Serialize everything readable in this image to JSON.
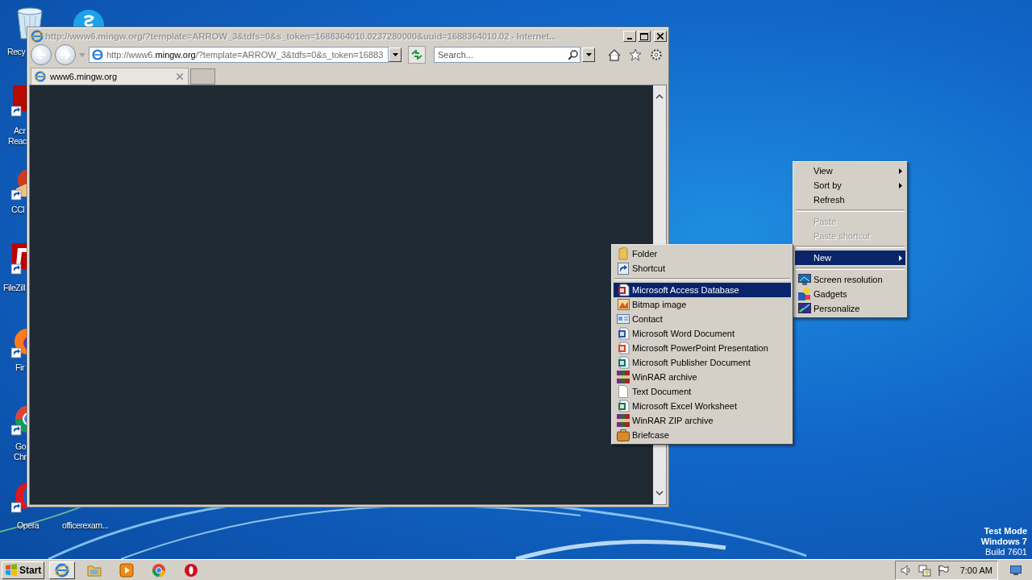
{
  "desktop": {
    "icons": [
      {
        "kind": "recycle",
        "lines": [
          "Recy"
        ]
      },
      {
        "kind": "skype"
      },
      {
        "kind": "pdf",
        "lines": [
          "Acr",
          "Reac"
        ]
      },
      {
        "kind": "ccleaner",
        "lines": [
          "CCl"
        ]
      },
      {
        "kind": "filezilla",
        "lines": [
          "FileZill"
        ]
      },
      {
        "kind": "firefox",
        "lines": [
          "Fir"
        ]
      },
      {
        "kind": "chrome",
        "lines": [
          "Go",
          "Chr"
        ]
      },
      {
        "kind": "opera",
        "lines": [
          "Opera"
        ]
      },
      {
        "kind": "file",
        "lines": [
          "officerexam..."
        ]
      }
    ],
    "os_notice": [
      "Test Mode",
      "Windows 7",
      "Build 7601"
    ]
  },
  "browser": {
    "title": "http://www6.mingw.org/?template=ARROW_3&tdfs=0&s_token=1688364010.0237280000&uuid=1688364010.02 - Internet...",
    "address": {
      "prefix": "http://www6.",
      "domain": "mingw.org",
      "suffix": "/?template=ARROW_3&tdfs=0&s_token=16883"
    },
    "search": {
      "placeholder": "Search..."
    },
    "tabs": [
      {
        "label": "www6.mingw.org",
        "selected": true
      }
    ]
  },
  "context_menu": {
    "items": [
      {
        "kind": "item",
        "label": "View",
        "submenu": true,
        "disabled": false,
        "selected": false
      },
      {
        "kind": "item",
        "label": "Sort by",
        "submenu": true,
        "disabled": false,
        "selected": false
      },
      {
        "kind": "item",
        "label": "Refresh",
        "submenu": false,
        "disabled": false,
        "selected": false
      },
      {
        "kind": "separator"
      },
      {
        "kind": "item",
        "label": "Paste",
        "submenu": false,
        "disabled": true,
        "selected": false
      },
      {
        "kind": "item",
        "label": "Paste shortcut",
        "submenu": false,
        "disabled": true,
        "selected": false
      },
      {
        "kind": "separator"
      },
      {
        "kind": "item",
        "label": "New",
        "submenu": true,
        "disabled": false,
        "selected": true
      },
      {
        "kind": "separator"
      },
      {
        "kind": "item",
        "label": "Screen resolution",
        "submenu": false,
        "disabled": false,
        "selected": false
      },
      {
        "kind": "item",
        "label": "Gadgets",
        "submenu": false,
        "disabled": false,
        "selected": false
      },
      {
        "kind": "item",
        "label": "Personalize",
        "submenu": false,
        "disabled": false,
        "selected": false
      }
    ]
  },
  "new_submenu": {
    "items": [
      {
        "kind": "item",
        "label": "Folder",
        "selected": false
      },
      {
        "kind": "item",
        "label": "Shortcut",
        "selected": false
      },
      {
        "kind": "separator"
      },
      {
        "kind": "item",
        "label": "Microsoft Access Database",
        "selected": true
      },
      {
        "kind": "item",
        "label": "Bitmap image",
        "selected": false
      },
      {
        "kind": "item",
        "label": "Contact",
        "selected": false
      },
      {
        "kind": "item",
        "label": "Microsoft Word Document",
        "selected": false
      },
      {
        "kind": "item",
        "label": "Microsoft PowerPoint Presentation",
        "selected": false
      },
      {
        "kind": "item",
        "label": "Microsoft Publisher Document",
        "selected": false
      },
      {
        "kind": "item",
        "label": "WinRAR archive",
        "selected": false
      },
      {
        "kind": "item",
        "label": "Text Document",
        "selected": false
      },
      {
        "kind": "item",
        "label": "Microsoft Excel Worksheet",
        "selected": false
      },
      {
        "kind": "item",
        "label": "WinRAR ZIP archive",
        "selected": false
      },
      {
        "kind": "item",
        "label": "Briefcase",
        "selected": false
      }
    ]
  },
  "taskbar": {
    "start": "Start",
    "apps": [
      {
        "kind": "ie",
        "selected": true
      },
      {
        "kind": "explorer",
        "selected": false
      },
      {
        "kind": "media",
        "selected": false
      },
      {
        "kind": "chrome",
        "selected": false
      },
      {
        "kind": "opera",
        "selected": false
      }
    ],
    "clock": "7:00 AM"
  }
}
